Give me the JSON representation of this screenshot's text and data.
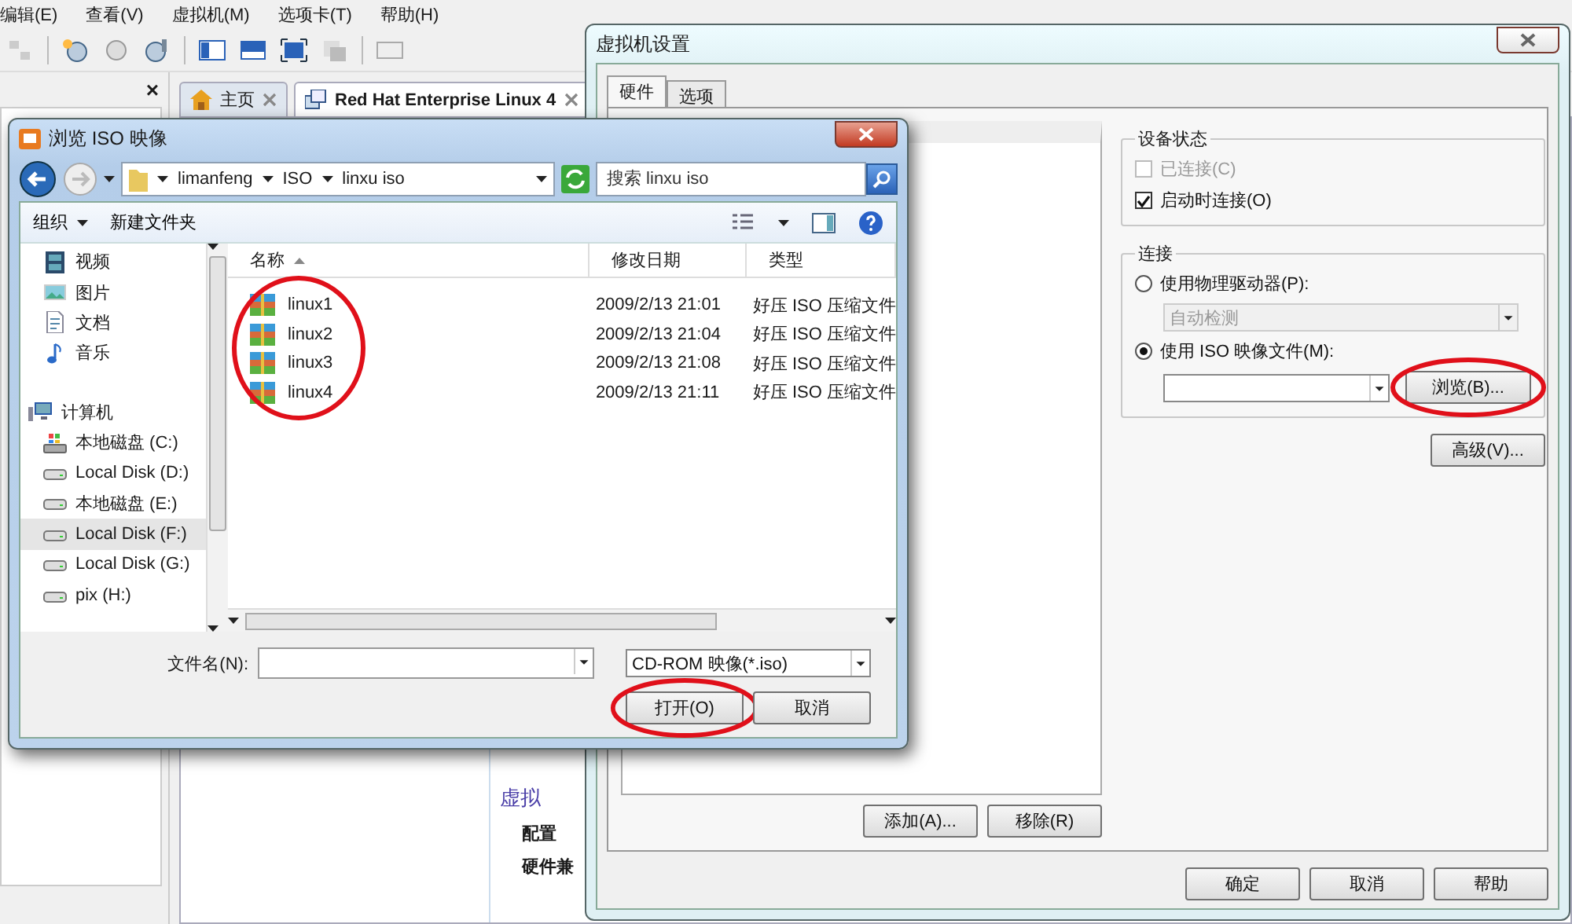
{
  "app": {
    "menu": [
      "编辑(E)",
      "查看(V)",
      "虚拟机(M)",
      "选项卡(T)",
      "帮助(H)"
    ],
    "panel_close": "×",
    "tabs": [
      {
        "label": "主页",
        "kind": "home",
        "selected": false
      },
      {
        "label": "Red Hat Enterprise Linux 4",
        "kind": "vm",
        "selected": true
      }
    ],
    "summary": {
      "section": "虚拟",
      "rows": [
        "配置",
        "硬件兼"
      ]
    }
  },
  "settings_dialog": {
    "title": "虚拟机设置",
    "tabs": [
      {
        "label": "硬件",
        "selected": true
      },
      {
        "label": "选项",
        "selected": false
      }
    ],
    "add_button": "添加(A)...",
    "remove_button": "移除(R)",
    "device_status": {
      "title": "设备状态",
      "options": [
        {
          "label": "已连接(C)",
          "checked": false,
          "disabled": true
        },
        {
          "label": "启动时连接(O)",
          "checked": true,
          "disabled": false
        }
      ]
    },
    "connection": {
      "title": "连接",
      "physical": {
        "label": "使用物理驱动器(P):",
        "selected": false
      },
      "drive_select": {
        "value": "自动检测",
        "disabled": true
      },
      "iso": {
        "label": "使用 ISO 映像文件(M):",
        "selected": true
      },
      "browse_button": {
        "label": "浏览(B)...",
        "circled": true
      }
    },
    "advanced_button": "高级(V)...",
    "buttons": [
      "确定",
      "取消",
      "帮助"
    ]
  },
  "file_dialog": {
    "title": "浏览 ISO 映像",
    "breadcrumb": [
      "limanfeng",
      "ISO",
      "linxu iso"
    ],
    "search": {
      "placeholder": "搜索 linxu iso"
    },
    "toolbar": {
      "organize": "组织",
      "new_folder": "新建文件夹"
    },
    "sidebar": [
      {
        "label": "视频",
        "kind": "video",
        "selected": false
      },
      {
        "label": "图片",
        "kind": "pictures",
        "selected": false
      },
      {
        "label": "文档",
        "kind": "documents",
        "selected": false
      },
      {
        "label": "音乐",
        "kind": "music",
        "selected": false
      },
      {
        "label": "计算机",
        "kind": "computer",
        "selected": false
      },
      {
        "label": "本地磁盘 (C:)",
        "kind": "system-drive",
        "selected": false
      },
      {
        "label": "Local Disk (D:)",
        "kind": "drive",
        "selected": false
      },
      {
        "label": "本地磁盘 (E:)",
        "kind": "drive",
        "selected": false
      },
      {
        "label": "Local Disk (F:)",
        "kind": "drive",
        "selected": true
      },
      {
        "label": "Local Disk (G:)",
        "kind": "drive",
        "selected": false
      },
      {
        "label": "pix (H:)",
        "kind": "drive",
        "selected": false
      }
    ],
    "columns": [
      "名称",
      "修改日期",
      "类型"
    ],
    "files": [
      {
        "name": "linux1",
        "modified": "2009/2/13 21:01",
        "type": "好压 ISO 压缩文件"
      },
      {
        "name": "linux2",
        "modified": "2009/2/13 21:04",
        "type": "好压 ISO 压缩文件"
      },
      {
        "name": "linux3",
        "modified": "2009/2/13 21:08",
        "type": "好压 ISO 压缩文件"
      },
      {
        "name": "linux4",
        "modified": "2009/2/13 21:11",
        "type": "好压 ISO 压缩文件"
      }
    ],
    "files_circled": true,
    "filename_label": "文件名(N):",
    "filetype": "CD-ROM 映像(*.iso)",
    "open_button": {
      "label": "打开(O)",
      "circled": true
    },
    "cancel_button": "取消"
  }
}
